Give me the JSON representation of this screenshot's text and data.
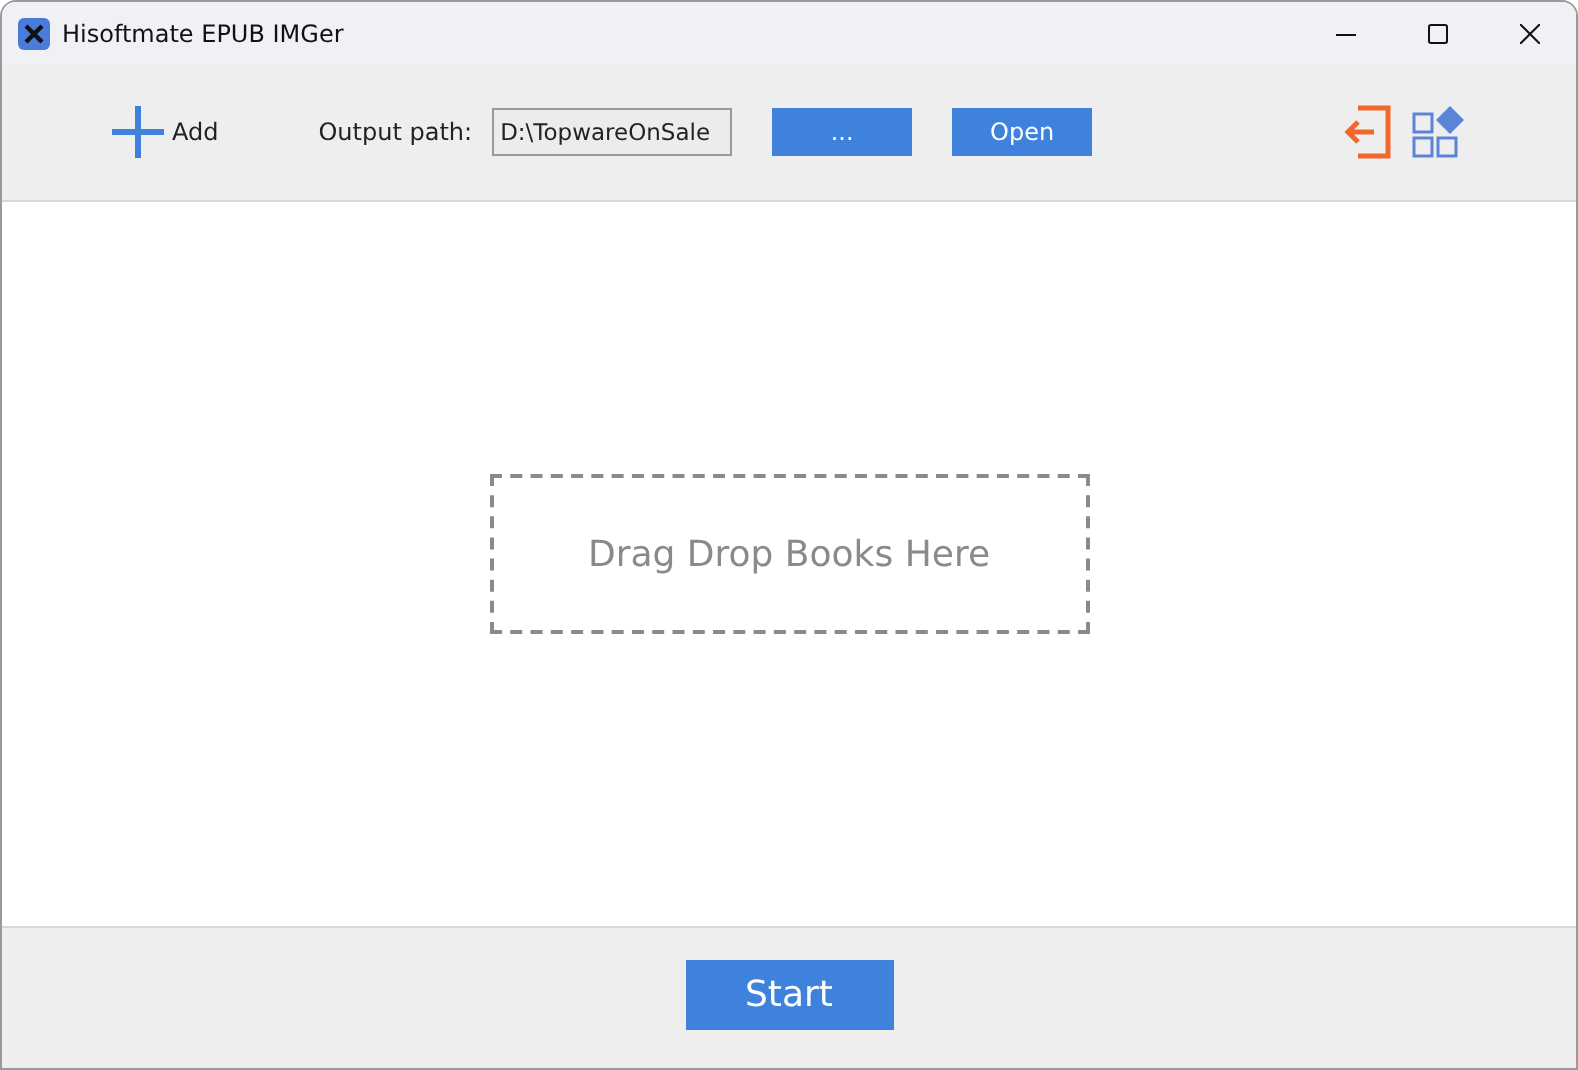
{
  "window": {
    "title": "Hisoftmate EPUB IMGer"
  },
  "toolbar": {
    "add_label": "Add",
    "output_label": "Output path:",
    "output_value": "D:\\TopwareOnSale",
    "browse_button": "...",
    "open_button": "Open"
  },
  "drop_zone": {
    "text": "Drag Drop Books Here"
  },
  "footer": {
    "start_button": "Start"
  }
}
